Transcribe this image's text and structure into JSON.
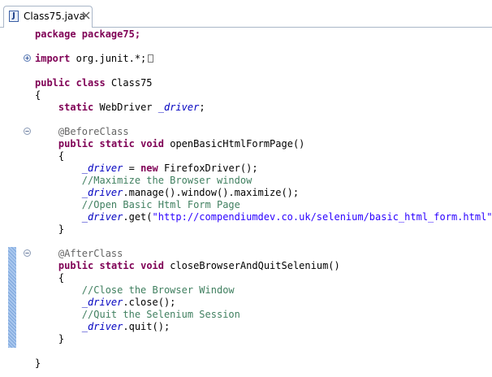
{
  "tab": {
    "title": "Class75.java",
    "file_icon_letter": "J"
  },
  "code_lines": {
    "l01": "package package75;",
    "l03_kw": "import",
    "l03_text": " org.junit.*;",
    "l05_kw1": "public",
    "l05_kw2": "class",
    "l05_name": " Class75",
    "l06": "{",
    "l07_kw": "static",
    "l07_type": " WebDriver ",
    "l07_field": "_driver",
    "l07_end": ";",
    "l09_ann": "@BeforeClass",
    "l10_kw1": "public",
    "l10_kw2": "static",
    "l10_kw3": "void",
    "l10_name": " openBasicHtmlFormPage()",
    "l11": "{",
    "l12_field": "_driver",
    "l12_mid": " = ",
    "l12_kw": "new",
    "l12_end": " FirefoxDriver();",
    "l13_cmt": "//Maximize the Browser window",
    "l14_field": "_driver",
    "l14_end": ".manage().window().maximize();",
    "l15_cmt": "//Open Basic Html Form Page",
    "l16_field": "_driver",
    "l16_mid": ".get(",
    "l16_str": "\"http://compendiumdev.co.uk/selenium/basic_html_form.html\"",
    "l16_end": ");",
    "l17": "}",
    "l19_ann": "@AfterClass",
    "l20_kw1": "public",
    "l20_kw2": "static",
    "l20_kw3": "void",
    "l20_name": " closeBrowserAndQuitSelenium()",
    "l21": "{",
    "l22_cmt": "//Close the Browser Window",
    "l23_field": "_driver",
    "l23_end": ".close();",
    "l24_cmt": "//Quit the Selenium Session",
    "l25_field": "_driver",
    "l25_end": ".quit();",
    "l26": "}",
    "l28": "}"
  },
  "colors": {
    "keyword": "#7f0055",
    "field": "#0000c0",
    "comment": "#3f7f5f",
    "string": "#2a00ff",
    "annotation": "#646464",
    "change_bar": "#a9c7ee"
  },
  "icons": {
    "tab_close": "close-icon",
    "import_fold": "fold-expand-icon",
    "method_fold": "fold-collapse-icon"
  }
}
